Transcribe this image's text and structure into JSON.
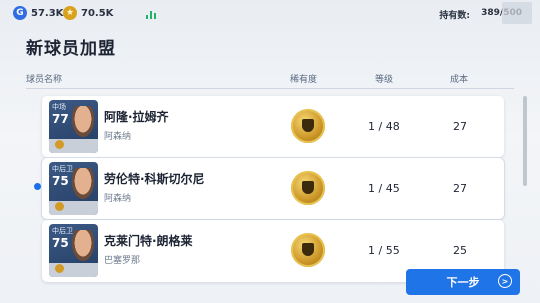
{
  "topbar": {
    "gp_value": "57.3K",
    "gp_icon": "G",
    "coin_value": "70.5K",
    "holdings_label": "持有数:",
    "holdings_value": "389/500"
  },
  "page": {
    "title": "新球员加盟"
  },
  "columns": {
    "player": "球员名称",
    "rarity": "稀有度",
    "level": "等级",
    "cost": "成本"
  },
  "players": [
    {
      "position": "中场",
      "rating": "77",
      "name": "阿隆·拉姆齐",
      "team": "阿森纳",
      "rarity": "gold-icon",
      "level": "1 / 48",
      "cost": "27",
      "selected": false
    },
    {
      "position": "中后卫",
      "rating": "75",
      "name": "劳伦特·科斯切尔尼",
      "team": "阿森纳",
      "rarity": "gold-icon",
      "level": "1 / 45",
      "cost": "27",
      "selected": true
    },
    {
      "position": "中后卫",
      "rating": "75",
      "name": "克莱门特·朗格莱",
      "team": "巴塞罗那",
      "rarity": "gold-icon",
      "level": "1 / 55",
      "cost": "25",
      "selected": false
    }
  ],
  "footer": {
    "next_label": "下一步"
  },
  "colors": {
    "accent": "#1f74e7",
    "gold": "#d8a21f",
    "background": "#eef1f5"
  }
}
